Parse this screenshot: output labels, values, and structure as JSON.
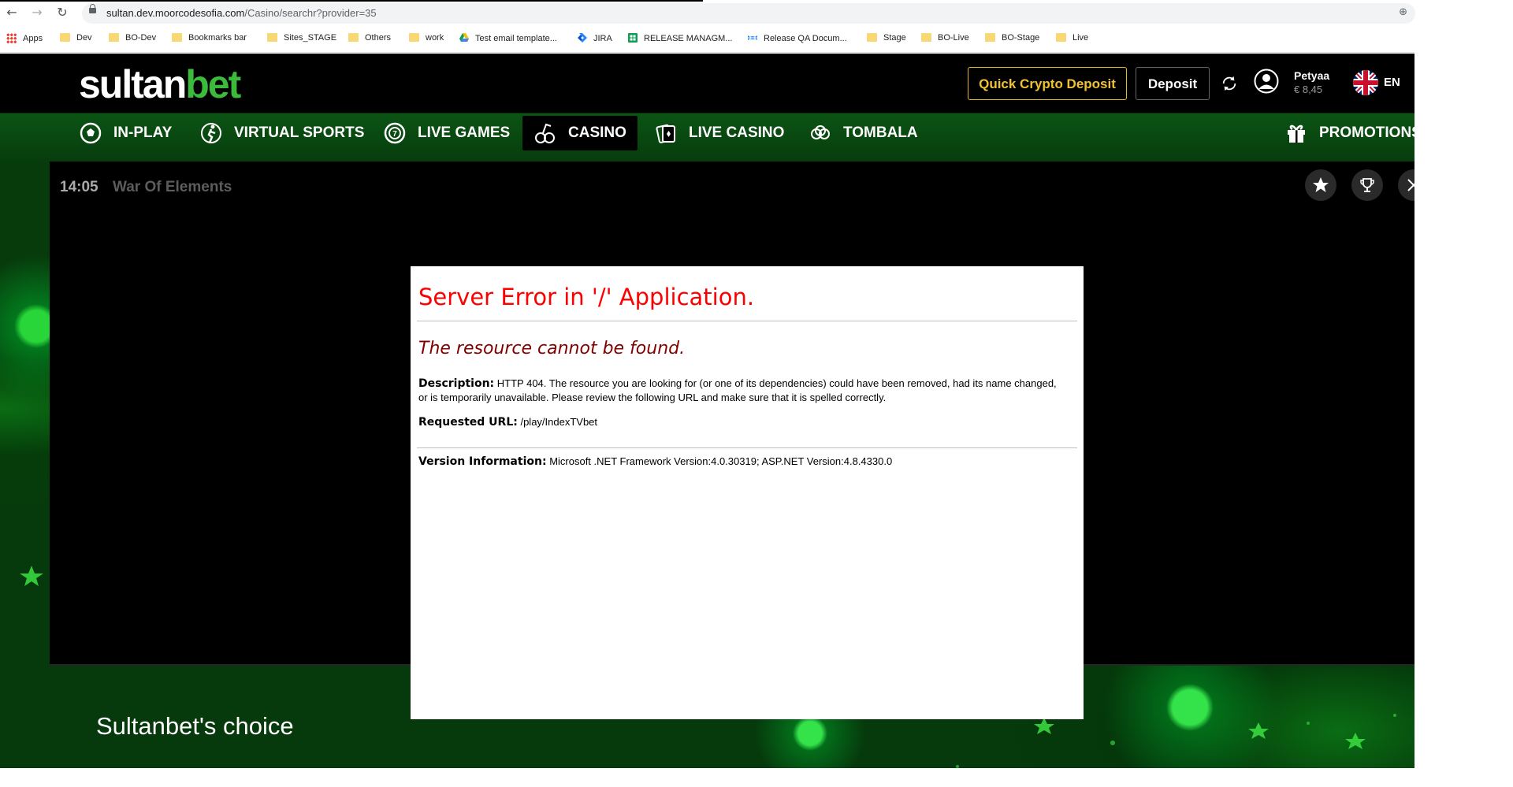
{
  "browser": {
    "url_domain": "sultan.dev.moorcodesofia.com",
    "url_path": "/Casino/searchr?provider=35",
    "bookmarks": [
      "Apps",
      "Dev",
      "BO-Dev",
      "Bookmarks bar",
      "Sites_STAGE",
      "Others",
      "work",
      "Test email template...",
      "JIRA",
      "RELEASE MANAGM...",
      "Release QA Docum...",
      "Stage",
      "BO-Live",
      "BO-Stage",
      "Live"
    ]
  },
  "header": {
    "logo_main": "sultan",
    "logo_accent": "bet",
    "crypto_button": "Quick Crypto Deposit",
    "deposit_button": "Deposit",
    "username": "Petyaa",
    "balance": "€ 8,45",
    "language": "EN"
  },
  "nav": {
    "items": [
      "IN-PLAY",
      "VIRTUAL SPORTS",
      "LIVE GAMES",
      "CASINO",
      "LIVE CASINO",
      "TOMBALA"
    ],
    "active": "CASINO",
    "promotions": "PROMOTIONS"
  },
  "game": {
    "time": "14:05",
    "title": "War Of Elements"
  },
  "error_page": {
    "title": "Server Error in '/' Application.",
    "subtitle": "The resource cannot be found.",
    "description_label": "Description:",
    "description_text": "HTTP 404. The resource you are looking for (or one of its dependencies) could have been removed, had its name changed, or is temporarily unavailable.  Please review the following URL and make sure that it is spelled correctly.",
    "requested_url_label": "Requested URL:",
    "requested_url": "/play/IndexTVbet",
    "version_label": "Version Information:",
    "version_text": "Microsoft .NET Framework Version:4.0.30319; ASP.NET Version:4.8.4330.0"
  },
  "section": {
    "title": "Sultanbet's choice"
  },
  "colors": {
    "brand_green": "#3cba3c",
    "crypto_gold": "#f1c232",
    "error_red": "#ff0000",
    "error_maroon": "#800000"
  }
}
